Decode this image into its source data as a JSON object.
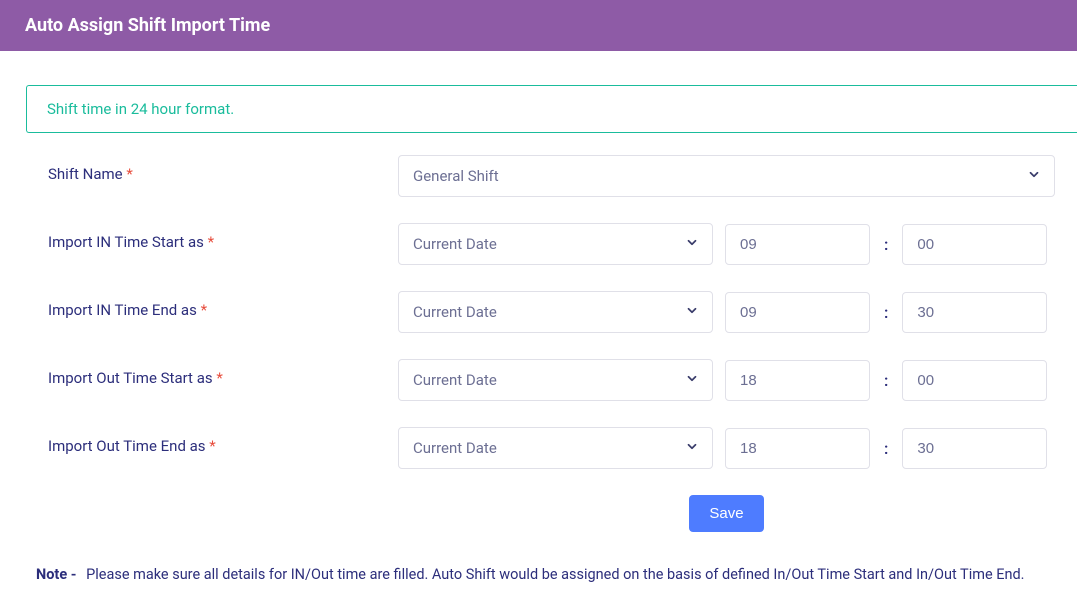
{
  "header": {
    "title": "Auto Assign Shift Import Time"
  },
  "alert": {
    "text": "Shift time in 24 hour format."
  },
  "labels": {
    "shift_name": "Shift Name",
    "in_start": "Import IN Time Start as",
    "in_end": "Import IN Time End as",
    "out_start": "Import Out Time Start as",
    "out_end": "Import Out Time End as",
    "required_mark": "*",
    "colon": ":"
  },
  "shift": {
    "selected": "General Shift"
  },
  "rows": {
    "in_start": {
      "date": "Current Date",
      "hour": "09",
      "minute": "00"
    },
    "in_end": {
      "date": "Current Date",
      "hour": "09",
      "minute": "30"
    },
    "out_start": {
      "date": "Current Date",
      "hour": "18",
      "minute": "00"
    },
    "out_end": {
      "date": "Current Date",
      "hour": "18",
      "minute": "30"
    }
  },
  "buttons": {
    "save": "Save"
  },
  "note": {
    "label": "Note -",
    "text": "Please make sure all details for IN/Out time are filled. Auto Shift would be assigned on the basis of defined In/Out Time Start and In/Out Time End."
  }
}
